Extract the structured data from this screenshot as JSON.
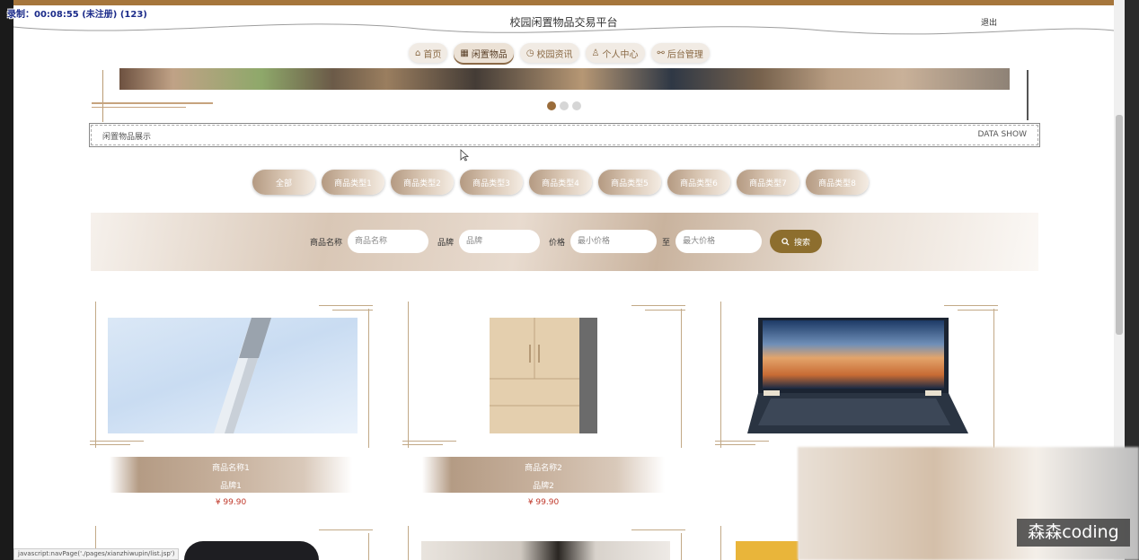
{
  "recording_overlay": "录制：00:08:55 (未注册) (123)",
  "site_title": "校园闲置物品交易平台",
  "logout_label": "退出",
  "nav": [
    {
      "icon": "home-icon",
      "glyph": "⌂",
      "label": "首页",
      "active": false
    },
    {
      "icon": "goods-icon",
      "glyph": "▦",
      "label": "闲置物品",
      "active": true
    },
    {
      "icon": "clock-icon",
      "glyph": "◷",
      "label": "校园资讯",
      "active": false
    },
    {
      "icon": "user-icon",
      "glyph": "♙",
      "label": "个人中心",
      "active": false
    },
    {
      "icon": "link-icon",
      "glyph": "⚯",
      "label": "后台管理",
      "active": false
    }
  ],
  "carousel": {
    "dot_count": 3,
    "active_index": 0
  },
  "section": {
    "title": "闲置物品展示",
    "subtitle": "DATA SHOW"
  },
  "categories": [
    "全部",
    "商品类型1",
    "商品类型2",
    "商品类型3",
    "商品类型4",
    "商品类型5",
    "商品类型6",
    "商品类型7",
    "商品类型8"
  ],
  "search": {
    "name_label": "商品名称",
    "name_placeholder": "商品名称",
    "brand_label": "品牌",
    "brand_placeholder": "品牌",
    "price_label": "价格",
    "min_placeholder": "最小价格",
    "to_label": "至",
    "max_placeholder": "最大价格",
    "button_label": "搜索"
  },
  "products": [
    {
      "name": "商品名称1",
      "brand": "品牌1",
      "price": "¥ 99.90"
    },
    {
      "name": "商品名称2",
      "brand": "品牌2",
      "price": "¥ 99.90"
    }
  ],
  "status_url": "javascript:navPage('./pages/xianzhiwupin/list.jsp')",
  "watermark": "森森coding",
  "colors": {
    "accent": "#a6763c",
    "search_button": "#8d6e2e",
    "price": "#c0392b"
  }
}
